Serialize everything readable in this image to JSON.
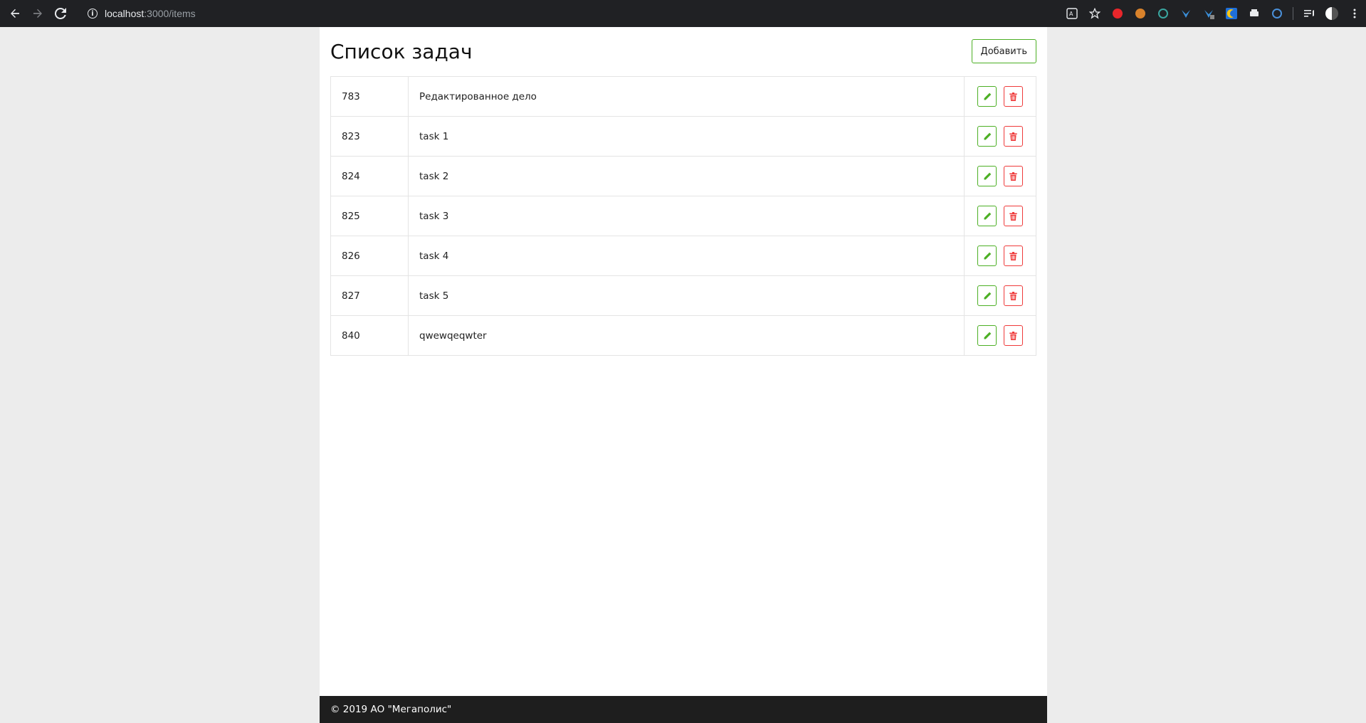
{
  "browser": {
    "url_host": "localhost",
    "url_path": ":3000/items",
    "info_glyph": "i"
  },
  "page": {
    "title": "Список задач",
    "add_button": "Добавить"
  },
  "tasks": [
    {
      "id": "783",
      "title": "Редактированное дело"
    },
    {
      "id": "823",
      "title": "task 1"
    },
    {
      "id": "824",
      "title": "task 2"
    },
    {
      "id": "825",
      "title": "task 3"
    },
    {
      "id": "826",
      "title": "task 4"
    },
    {
      "id": "827",
      "title": "task 5"
    },
    {
      "id": "840",
      "title": "qwewqeqwter"
    }
  ],
  "footer": {
    "text": "© 2019 АО \"Мегаполис\""
  },
  "colors": {
    "edit_accent": "#4caf24",
    "delete_accent": "#ef3a3a",
    "footer_bg": "#1e1e1e",
    "browser_bg": "#202124"
  },
  "icons": {
    "row_edit": "pencil-icon",
    "row_delete": "trash-icon"
  }
}
